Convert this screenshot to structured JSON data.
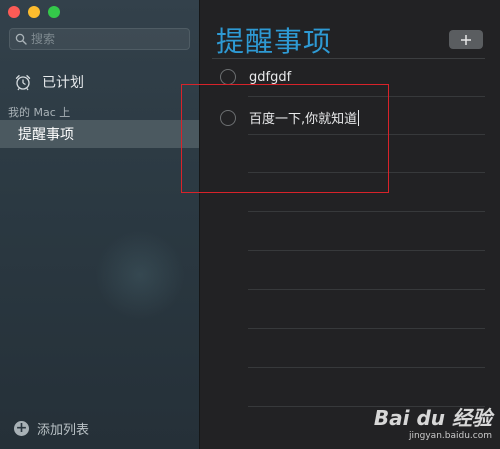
{
  "sidebar": {
    "search_placeholder": "搜索",
    "scheduled_label": "已计划",
    "section_title": "我的 Mac 上",
    "selected_list": "提醒事项",
    "add_list_label": "添加列表"
  },
  "main": {
    "title": "提醒事项",
    "add_button_icon": "plus-icon",
    "reminders": [
      {
        "text": "gdfgdf",
        "completed": false
      },
      {
        "text": "百度一下,你就知道",
        "completed": false,
        "editing": true
      }
    ]
  },
  "watermark": {
    "logo": "Bai du 经验",
    "url": "jingyan.baidu.com"
  },
  "colors": {
    "accent": "#2e9ad4",
    "annotation": "#d8232a",
    "traffic_close": "#fc5b56",
    "traffic_minimize": "#fdbc2e",
    "traffic_maximize": "#34c84a"
  }
}
